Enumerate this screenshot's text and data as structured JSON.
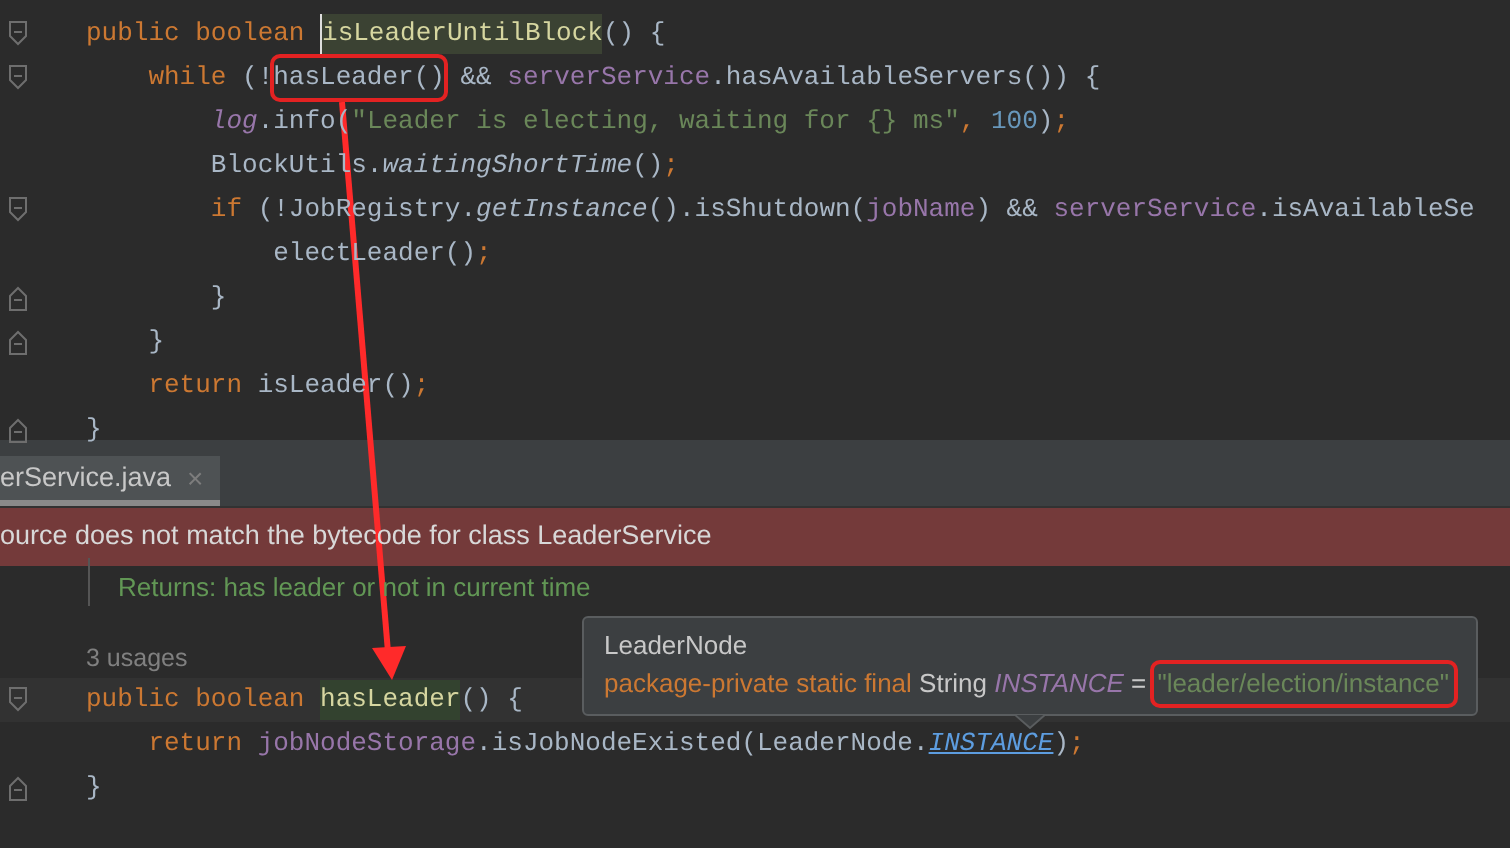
{
  "editor": {
    "lines": [
      {
        "kind": "fold_start",
        "tokens": [
          {
            "text": "public boolean ",
            "kind": "kw"
          },
          {
            "text": "isLeaderUntilBlock",
            "kind": "decl"
          },
          {
            "text": "() {",
            "kind": "plain"
          }
        ]
      },
      {
        "kind": "fold_start",
        "tokens": [
          {
            "text": "    while",
            "kind": "kw"
          },
          {
            "text": " (!",
            "kind": "plain"
          },
          {
            "text": "hasLeader()",
            "kind": "plain",
            "boxed": true
          },
          {
            "text": " && ",
            "kind": "plain"
          },
          {
            "text": "serverService",
            "kind": "field"
          },
          {
            "text": ".hasAvailableServers()) {",
            "kind": "plain"
          }
        ]
      },
      {
        "kind": "plain",
        "tokens": [
          {
            "text": "        log",
            "kind": "const"
          },
          {
            "text": ".info(",
            "kind": "plain"
          },
          {
            "text": "\"Leader is electing, waiting for {} ms\"",
            "kind": "str"
          },
          {
            "text": ", ",
            "kind": "kw"
          },
          {
            "text": "100",
            "kind": "num"
          },
          {
            "text": ")",
            "kind": "plain"
          },
          {
            "text": ";",
            "kind": "kw"
          }
        ]
      },
      {
        "kind": "plain",
        "tokens": [
          {
            "text": "        BlockUtils.",
            "kind": "plain"
          },
          {
            "text": "waitingShortTime",
            "kind": "italic"
          },
          {
            "text": "()",
            "kind": "plain"
          },
          {
            "text": ";",
            "kind": "kw"
          }
        ]
      },
      {
        "kind": "fold_start",
        "tokens": [
          {
            "text": "        if",
            "kind": "kw"
          },
          {
            "text": " (!JobRegistry.",
            "kind": "plain"
          },
          {
            "text": "getInstance",
            "kind": "italic"
          },
          {
            "text": "().isShutdown(",
            "kind": "plain"
          },
          {
            "text": "jobName",
            "kind": "field"
          },
          {
            "text": ") && ",
            "kind": "plain"
          },
          {
            "text": "serverService",
            "kind": "field"
          },
          {
            "text": ".isAvailableSe",
            "kind": "plain"
          }
        ]
      },
      {
        "kind": "plain",
        "tokens": [
          {
            "text": "            electLeader()",
            "kind": "plain"
          },
          {
            "text": ";",
            "kind": "kw"
          }
        ]
      },
      {
        "kind": "fold_end",
        "tokens": [
          {
            "text": "        }",
            "kind": "plain"
          }
        ]
      },
      {
        "kind": "fold_end",
        "tokens": [
          {
            "text": "    }",
            "kind": "plain"
          }
        ]
      },
      {
        "kind": "plain",
        "tokens": [
          {
            "text": "    return",
            "kind": "kw"
          },
          {
            "text": " isLeader()",
            "kind": "plain"
          },
          {
            "text": ";",
            "kind": "kw"
          }
        ]
      },
      {
        "kind": "fold_end",
        "tokens": [
          {
            "text": "}",
            "kind": "plain"
          }
        ]
      }
    ]
  },
  "file_tab": {
    "label": "erService.java",
    "close": "×",
    "selected": true
  },
  "banner": {
    "text": "ource does not match the bytecode for class LeaderService"
  },
  "doc": {
    "returns": "Returns: has leader or not in current time"
  },
  "usages": "3 usages",
  "method": {
    "lines": [
      {
        "kind": "fold_start",
        "tokens": [
          {
            "text": "public boolean ",
            "kind": "kw"
          },
          {
            "text": "hasLeader",
            "kind": "decl"
          },
          {
            "text": "() {",
            "kind": "plain"
          }
        ]
      },
      {
        "kind": "plain",
        "tokens": [
          {
            "text": "    return",
            "kind": "kw"
          },
          {
            "text": " jobNodeStorage",
            "kind": "field"
          },
          {
            "text": ".isJobNodeExisted(LeaderNode.",
            "kind": "plain"
          },
          {
            "text": "INSTANCE",
            "kind": "link"
          },
          {
            "text": ")",
            "kind": "plain"
          },
          {
            "text": ";",
            "kind": "kw"
          }
        ]
      },
      {
        "kind": "fold_end",
        "tokens": [
          {
            "text": "}",
            "kind": "plain"
          }
        ]
      }
    ]
  },
  "tooltip": {
    "title": "LeaderNode",
    "tokens": [
      {
        "text": "package-private static final ",
        "kind": "kw"
      },
      {
        "text": "String ",
        "kind": "plain"
      },
      {
        "text": "INSTANCE",
        "kind": "const"
      },
      {
        "text": " = ",
        "kind": "plain"
      },
      {
        "text": "\"leader/election/instance\"",
        "kind": "str",
        "boxed": true
      }
    ]
  }
}
